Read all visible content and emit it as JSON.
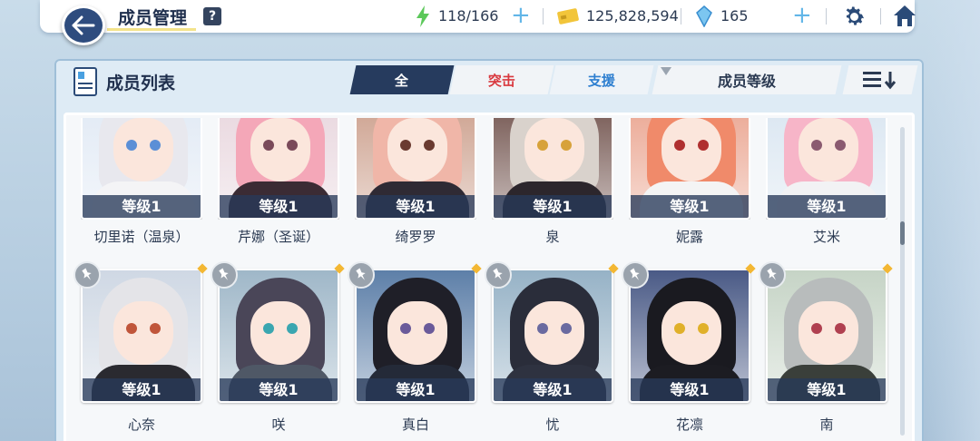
{
  "header": {
    "title": "成员管理",
    "help_label": "?",
    "stamina": "118/166",
    "credits": "125,828,594",
    "gems": "165",
    "plus_symbol": "+"
  },
  "panel": {
    "title": "成员列表",
    "tabs": [
      {
        "label": "全",
        "active": true
      },
      {
        "label": "突击",
        "active": false
      },
      {
        "label": "支援",
        "active": false
      }
    ],
    "sort_label": "成员等级"
  },
  "members_row1": [
    {
      "name": "切里诺（温泉）",
      "level": "等级1",
      "hair": "#e8e8ee",
      "eye": "#5b8fd6",
      "bg": "#dfe8f4",
      "outfit": "#f4f4f6"
    },
    {
      "name": "芹娜（圣诞）",
      "level": "等级1",
      "hair": "#f4a7b8",
      "eye": "#7a4a5a",
      "bg": "#e7d4dc",
      "outfit": "#3b2b34"
    },
    {
      "name": "绮罗罗",
      "level": "等级1",
      "hair": "#f0b6a8",
      "eye": "#6a3a30",
      "bg": "#c99a86",
      "outfit": "#2f2a34"
    },
    {
      "name": "泉",
      "level": "等级1",
      "hair": "#d9d2cc",
      "eye": "#d7a23a",
      "bg": "#6a4a44",
      "outfit": "#2c262c"
    },
    {
      "name": "妮露",
      "level": "等级1",
      "hair": "#f08a6a",
      "eye": "#b03030",
      "bg": "#e9a08a",
      "outfit": "#f4f4f4"
    },
    {
      "name": "艾米",
      "level": "等级1",
      "hair": "#f7b5c8",
      "eye": "#8a5a70",
      "bg": "#d7e4f0",
      "outfit": "#f2f2f4"
    }
  ],
  "members_row2": [
    {
      "name": "心奈",
      "level": "等级1",
      "hair": "#e4e4e8",
      "eye": "#c0553a",
      "bg": "#cfd8e4",
      "outfit": "#2a2a30"
    },
    {
      "name": "咲",
      "level": "等级1",
      "hair": "#4a4658",
      "eye": "#3aa6b0",
      "bg": "#9fb7c8",
      "outfit": "#4f5866"
    },
    {
      "name": "真白",
      "level": "等级1",
      "hair": "#1f1f28",
      "eye": "#6a5a9a",
      "bg": "#5d7fa8",
      "outfit": "#242a38"
    },
    {
      "name": "忧",
      "level": "等级1",
      "hair": "#2a2d3a",
      "eye": "#6a6aa0",
      "bg": "#96b2c6",
      "outfit": "#2e3240"
    },
    {
      "name": "花凛",
      "level": "等级1",
      "hair": "#1a1a20",
      "eye": "#e0b02a",
      "bg": "#4a5a86",
      "outfit": "#1c1c22"
    },
    {
      "name": "南",
      "level": "等级1",
      "hair": "#b8bcbc",
      "eye": "#b04050",
      "bg": "#c6d4c6",
      "outfit": "#3a3f3a"
    }
  ],
  "icons": [
    "back-arrow-icon",
    "help-icon",
    "stamina-bolt-icon",
    "credit-card-icon",
    "gem-icon",
    "settings-gear-icon",
    "home-icon",
    "member-list-icon",
    "filter-icon",
    "sort-order-icon",
    "pin-icon"
  ]
}
